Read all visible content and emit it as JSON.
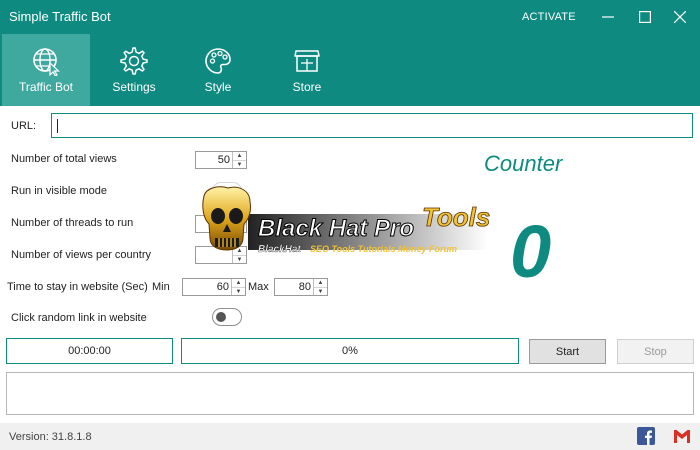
{
  "window": {
    "title": "Simple Traffic Bot",
    "activate_label": "ACTIVATE",
    "controls": [
      "minimize",
      "maximize",
      "close"
    ]
  },
  "nav": {
    "items": [
      {
        "label": "Traffic Bot",
        "icon": "globe-cursor-icon",
        "active": true
      },
      {
        "label": "Settings",
        "icon": "gear-icon",
        "active": false
      },
      {
        "label": "Style",
        "icon": "palette-icon",
        "active": false
      },
      {
        "label": "Store",
        "icon": "store-icon",
        "active": false
      }
    ]
  },
  "form": {
    "url_label": "URL:",
    "url_value": "",
    "total_views_label": "Number of total views",
    "total_views_value": "50",
    "visible_mode_label": "Run in visible mode",
    "visible_mode_on": false,
    "threads_label": "Number of threads to run",
    "views_per_country_label": "Number of views per country",
    "stay_time_label": "Time to stay in website (Sec)",
    "min_label": "Min",
    "min_value": "60",
    "max_label": "Max",
    "max_value": "80",
    "random_link_label": "Click random link in website",
    "random_link_on": false
  },
  "counter": {
    "title": "Counter",
    "value": "0"
  },
  "watermark": {
    "title": "Black Hat Pro Tools",
    "subtitle": "BlackHat SEO Tools Tutorials Money Forum"
  },
  "run": {
    "timer": "00:00:00",
    "progress_text": "0%",
    "progress": 0,
    "start_label": "Start",
    "stop_label": "Stop"
  },
  "status": {
    "version": "Version: 31.8.1.8",
    "social": [
      "facebook-icon",
      "gmail-icon"
    ]
  },
  "colors": {
    "accent": "#0e8a80",
    "nav_active": "#3fa89f",
    "facebook": "#3b5998",
    "gmail": "#d93025"
  }
}
